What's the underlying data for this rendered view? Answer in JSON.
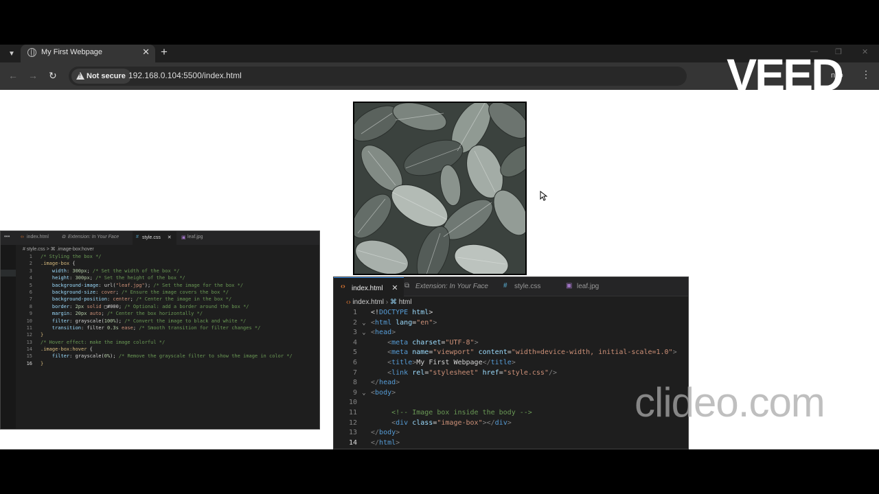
{
  "browser": {
    "tab_title": "My First Webpage",
    "tab_close": "✕",
    "new_tab": "+",
    "security_label": "Not secure",
    "url": "192.168.0.104:5500/index.html",
    "incognito_text": "nito"
  },
  "small_editor": {
    "tabs": [
      {
        "label": "index.html",
        "icon": "html-icon"
      },
      {
        "label": "Extension: In Your Face",
        "icon": "extension-icon"
      },
      {
        "label": "style.css",
        "icon": "css-icon"
      },
      {
        "label": "leaf.jpg",
        "icon": "image-icon"
      }
    ],
    "active_tab_close": "✕",
    "breadcrumb": "# style.css > ⌘ .image-box:hover",
    "lines": [
      {
        "n": "1",
        "parts": [
          {
            "c": "com",
            "t": "/* Styling the box */"
          }
        ]
      },
      {
        "n": "2",
        "parts": [
          {
            "c": "sel",
            "t": ".image-box "
          },
          {
            "c": "plain",
            "t": "{"
          }
        ]
      },
      {
        "n": "3",
        "parts": [
          {
            "c": "plain",
            "t": "    "
          },
          {
            "c": "prop",
            "t": "width"
          },
          {
            "c": "plain",
            "t": ": "
          },
          {
            "c": "num",
            "t": "300px"
          },
          {
            "c": "plain",
            "t": "; "
          },
          {
            "c": "com",
            "t": "/* Set the width of the box */"
          }
        ]
      },
      {
        "n": "4",
        "parts": [
          {
            "c": "plain",
            "t": "    "
          },
          {
            "c": "prop",
            "t": "height"
          },
          {
            "c": "plain",
            "t": ": "
          },
          {
            "c": "num",
            "t": "300px"
          },
          {
            "c": "plain",
            "t": "; "
          },
          {
            "c": "com",
            "t": "/* Set the height of the box */"
          }
        ]
      },
      {
        "n": "5",
        "parts": [
          {
            "c": "plain",
            "t": "    "
          },
          {
            "c": "prop",
            "t": "background-image"
          },
          {
            "c": "plain",
            "t": ": url("
          },
          {
            "c": "val",
            "t": "\"leaf.jpg\""
          },
          {
            "c": "plain",
            "t": "); "
          },
          {
            "c": "com",
            "t": "/* Set the image for the box */"
          }
        ]
      },
      {
        "n": "6",
        "parts": [
          {
            "c": "plain",
            "t": "    "
          },
          {
            "c": "prop",
            "t": "background-size"
          },
          {
            "c": "plain",
            "t": ": "
          },
          {
            "c": "val",
            "t": "cover"
          },
          {
            "c": "plain",
            "t": "; "
          },
          {
            "c": "com",
            "t": "/* Ensure the image covers the box */"
          }
        ]
      },
      {
        "n": "7",
        "parts": [
          {
            "c": "plain",
            "t": "    "
          },
          {
            "c": "prop",
            "t": "background-position"
          },
          {
            "c": "plain",
            "t": ": "
          },
          {
            "c": "val",
            "t": "center"
          },
          {
            "c": "plain",
            "t": "; "
          },
          {
            "c": "com",
            "t": "/* Center the image in the box */"
          }
        ]
      },
      {
        "n": "8",
        "parts": [
          {
            "c": "plain",
            "t": "    "
          },
          {
            "c": "prop",
            "t": "border"
          },
          {
            "c": "plain",
            "t": ": "
          },
          {
            "c": "num",
            "t": "2px"
          },
          {
            "c": "val",
            "t": " solid "
          },
          {
            "c": "plain",
            "t": "□#000; "
          },
          {
            "c": "com",
            "t": "/* Optional: add a border around the box */"
          }
        ]
      },
      {
        "n": "9",
        "parts": [
          {
            "c": "plain",
            "t": "    "
          },
          {
            "c": "prop",
            "t": "margin"
          },
          {
            "c": "plain",
            "t": ": "
          },
          {
            "c": "num",
            "t": "20px"
          },
          {
            "c": "val",
            "t": " auto"
          },
          {
            "c": "plain",
            "t": "; "
          },
          {
            "c": "com",
            "t": "/* Center the box horizontally */"
          }
        ]
      },
      {
        "n": "10",
        "parts": [
          {
            "c": "plain",
            "t": "    "
          },
          {
            "c": "prop",
            "t": "filter"
          },
          {
            "c": "plain",
            "t": ": grayscale("
          },
          {
            "c": "num",
            "t": "100%"
          },
          {
            "c": "plain",
            "t": "); "
          },
          {
            "c": "com",
            "t": "/* Convert the image to black and white */"
          }
        ]
      },
      {
        "n": "11",
        "parts": [
          {
            "c": "plain",
            "t": "    "
          },
          {
            "c": "prop",
            "t": "transition"
          },
          {
            "c": "plain",
            "t": ": filter "
          },
          {
            "c": "num",
            "t": "0.3s"
          },
          {
            "c": "val",
            "t": " ease"
          },
          {
            "c": "plain",
            "t": "; "
          },
          {
            "c": "com",
            "t": "/* Smooth transition for filter changes */"
          }
        ]
      },
      {
        "n": "12",
        "parts": [
          {
            "c": "sel",
            "t": "}"
          }
        ]
      },
      {
        "n": "13",
        "parts": [
          {
            "c": "com",
            "t": "/* Hover effect: make the image colorful */"
          }
        ]
      },
      {
        "n": "14",
        "parts": [
          {
            "c": "sel",
            "t": ".image-box:hover "
          },
          {
            "c": "plain",
            "t": "{"
          }
        ]
      },
      {
        "n": "15",
        "parts": [
          {
            "c": "plain",
            "t": "    "
          },
          {
            "c": "prop",
            "t": "filter"
          },
          {
            "c": "plain",
            "t": ": grayscale("
          },
          {
            "c": "num",
            "t": "0%"
          },
          {
            "c": "plain",
            "t": "); "
          },
          {
            "c": "com",
            "t": "/* Remove the grayscale filter to show the image in color */"
          }
        ]
      },
      {
        "n": "16",
        "parts": [
          {
            "c": "sel",
            "t": "}"
          }
        ]
      }
    ]
  },
  "large_editor": {
    "tabs": [
      {
        "label": "index.html",
        "icon": "html-icon",
        "active": true
      },
      {
        "label": "Extension: In Your Face",
        "icon": "extension-icon"
      },
      {
        "label": "style.css",
        "icon": "css-icon"
      },
      {
        "label": "leaf.jpg",
        "icon": "image-icon"
      }
    ],
    "active_tab_close": "✕",
    "breadcrumb_file": "index.html",
    "breadcrumb_node": "html",
    "lines": [
      {
        "n": "1",
        "fold": "",
        "parts": [
          {
            "c": "plain",
            "t": "<!"
          },
          {
            "c": "tag",
            "t": "DOCTYPE"
          },
          {
            "c": "attr",
            "t": " html"
          },
          {
            "c": "plain",
            "t": ">"
          }
        ]
      },
      {
        "n": "2",
        "fold": "⌄",
        "parts": [
          {
            "c": "punc",
            "t": "<"
          },
          {
            "c": "tag",
            "t": "html"
          },
          {
            "c": "attr",
            "t": " lang"
          },
          {
            "c": "plain",
            "t": "="
          },
          {
            "c": "str",
            "t": "\"en\""
          },
          {
            "c": "punc",
            "t": ">"
          }
        ]
      },
      {
        "n": "3",
        "fold": "⌄",
        "parts": [
          {
            "c": "punc",
            "t": "<"
          },
          {
            "c": "tag",
            "t": "head"
          },
          {
            "c": "punc",
            "t": ">"
          }
        ]
      },
      {
        "n": "4",
        "fold": "",
        "parts": [
          {
            "c": "plain",
            "t": "    "
          },
          {
            "c": "punc",
            "t": "<"
          },
          {
            "c": "tag",
            "t": "meta"
          },
          {
            "c": "attr",
            "t": " charset"
          },
          {
            "c": "plain",
            "t": "="
          },
          {
            "c": "str",
            "t": "\"UTF-8\""
          },
          {
            "c": "punc",
            "t": ">"
          }
        ]
      },
      {
        "n": "5",
        "fold": "",
        "parts": [
          {
            "c": "plain",
            "t": "    "
          },
          {
            "c": "punc",
            "t": "<"
          },
          {
            "c": "tag",
            "t": "meta"
          },
          {
            "c": "attr",
            "t": " name"
          },
          {
            "c": "plain",
            "t": "="
          },
          {
            "c": "str",
            "t": "\"viewport\""
          },
          {
            "c": "attr",
            "t": " content"
          },
          {
            "c": "plain",
            "t": "="
          },
          {
            "c": "str",
            "t": "\"width=device-width, initial-scale=1.0\""
          },
          {
            "c": "punc",
            "t": ">"
          }
        ]
      },
      {
        "n": "6",
        "fold": "",
        "parts": [
          {
            "c": "plain",
            "t": "    "
          },
          {
            "c": "punc",
            "t": "<"
          },
          {
            "c": "tag",
            "t": "title"
          },
          {
            "c": "punc",
            "t": ">"
          },
          {
            "c": "plain",
            "t": "My First Webpage"
          },
          {
            "c": "punc",
            "t": "</"
          },
          {
            "c": "tag",
            "t": "title"
          },
          {
            "c": "punc",
            "t": ">"
          }
        ]
      },
      {
        "n": "7",
        "fold": "",
        "parts": [
          {
            "c": "plain",
            "t": "    "
          },
          {
            "c": "punc",
            "t": "<"
          },
          {
            "c": "tag",
            "t": "link"
          },
          {
            "c": "attr",
            "t": " rel"
          },
          {
            "c": "plain",
            "t": "="
          },
          {
            "c": "str",
            "t": "\"stylesheet\""
          },
          {
            "c": "attr",
            "t": " href"
          },
          {
            "c": "plain",
            "t": "="
          },
          {
            "c": "str",
            "t": "\"style.css\""
          },
          {
            "c": "punc",
            "t": "/>"
          }
        ]
      },
      {
        "n": "8",
        "fold": "",
        "parts": [
          {
            "c": "punc",
            "t": "</"
          },
          {
            "c": "tag",
            "t": "head"
          },
          {
            "c": "punc",
            "t": ">"
          }
        ]
      },
      {
        "n": "9",
        "fold": "⌄",
        "parts": [
          {
            "c": "punc",
            "t": "<"
          },
          {
            "c": "tag",
            "t": "body"
          },
          {
            "c": "punc",
            "t": ">"
          }
        ]
      },
      {
        "n": "10",
        "fold": "",
        "parts": []
      },
      {
        "n": "11",
        "fold": "",
        "parts": [
          {
            "c": "plain",
            "t": "     "
          },
          {
            "c": "com",
            "t": "<!-- Image box inside the body -->"
          }
        ]
      },
      {
        "n": "12",
        "fold": "",
        "parts": [
          {
            "c": "plain",
            "t": "     "
          },
          {
            "c": "punc",
            "t": "<"
          },
          {
            "c": "tag",
            "t": "div"
          },
          {
            "c": "attr",
            "t": " class"
          },
          {
            "c": "plain",
            "t": "="
          },
          {
            "c": "str",
            "t": "\"image-box\""
          },
          {
            "c": "punc",
            "t": "></"
          },
          {
            "c": "tag",
            "t": "div"
          },
          {
            "c": "punc",
            "t": ">"
          }
        ]
      },
      {
        "n": "13",
        "fold": "",
        "parts": [
          {
            "c": "punc",
            "t": "</"
          },
          {
            "c": "tag",
            "t": "body"
          },
          {
            "c": "punc",
            "t": ">"
          }
        ]
      },
      {
        "n": "14",
        "fold": "",
        "parts": [
          {
            "c": "punc",
            "t": "</"
          },
          {
            "c": "tag",
            "t": "html"
          },
          {
            "c": "punc",
            "t": ">"
          }
        ]
      }
    ]
  },
  "watermarks": {
    "top": "VEED",
    "bottom": "clideo.com"
  }
}
